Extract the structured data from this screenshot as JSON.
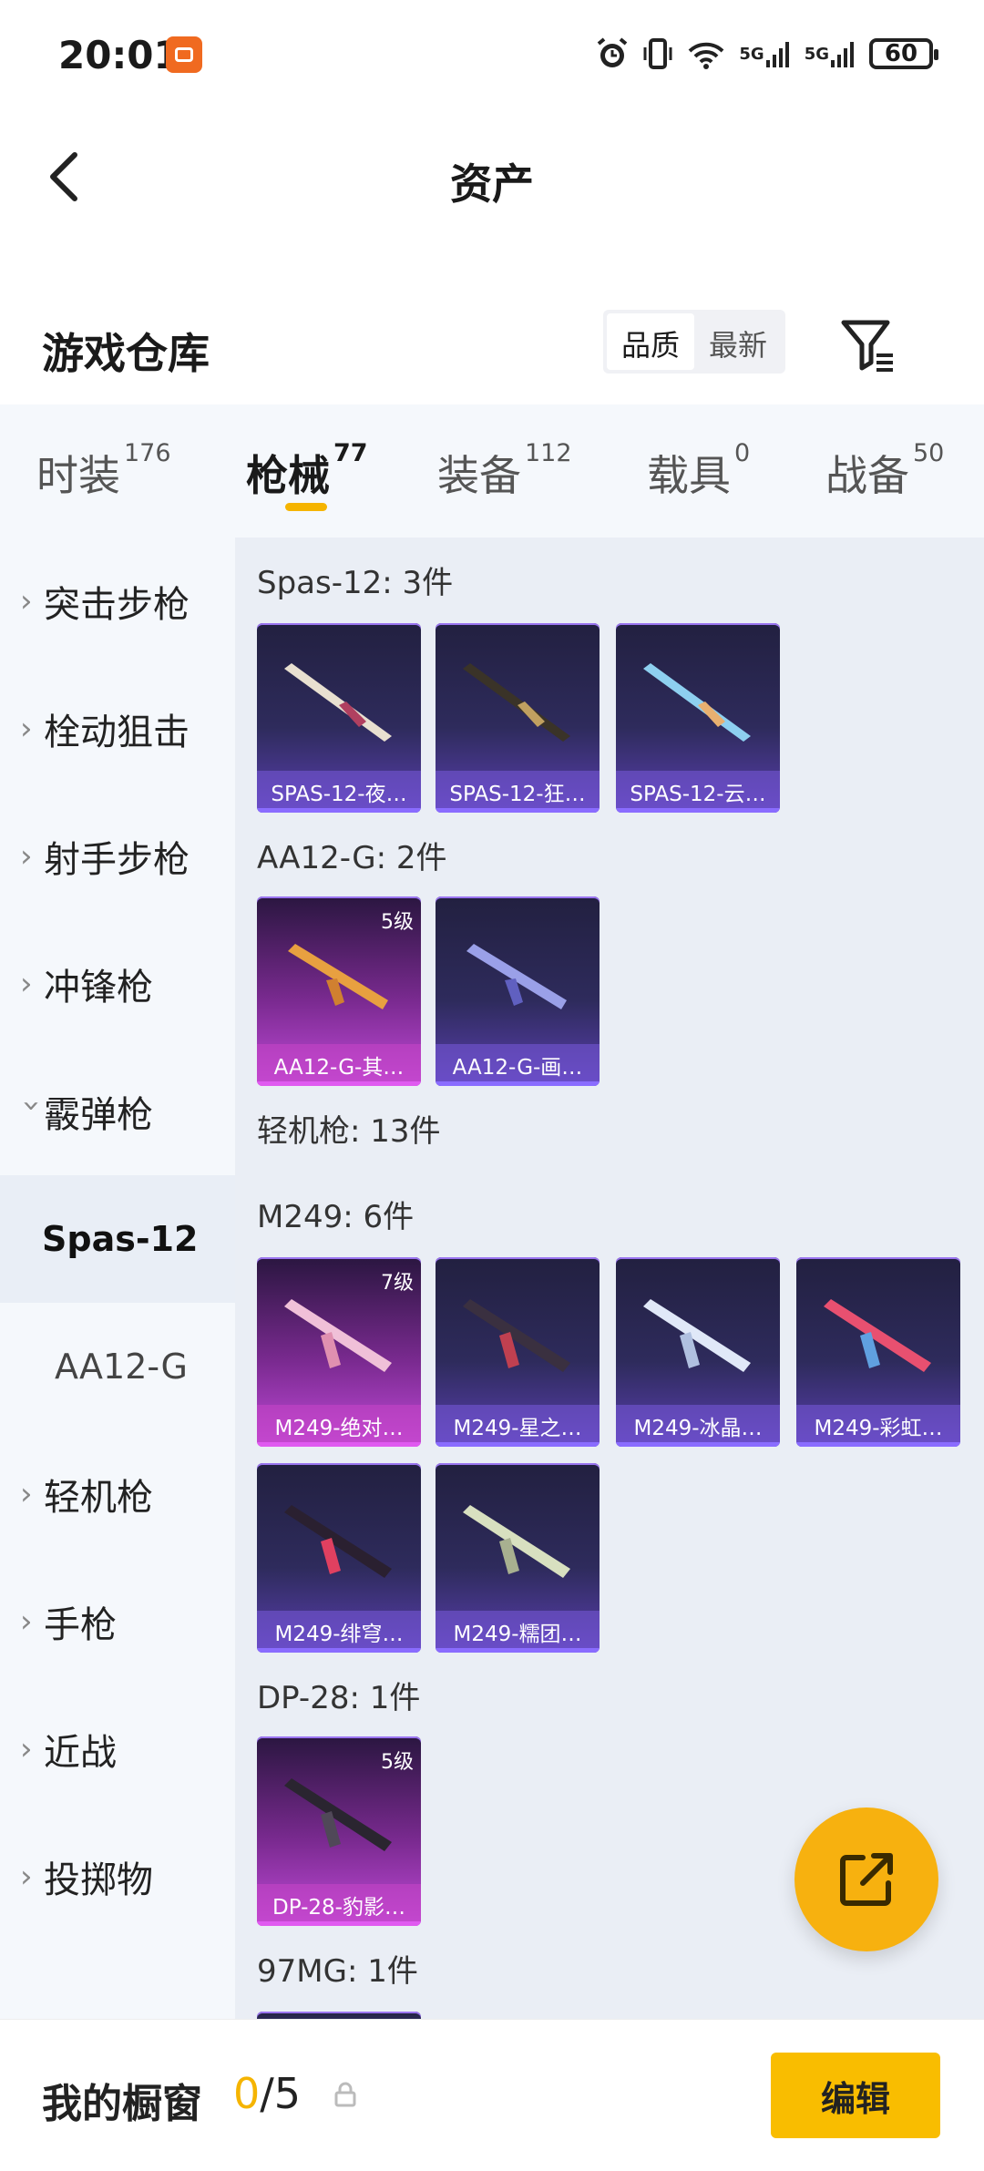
{
  "status_bar": {
    "time": "20:01",
    "battery": "60",
    "network1": "5G",
    "network2": "5G",
    "wifi_note": "6"
  },
  "nav": {
    "title": "资产"
  },
  "section": {
    "title": "游戏仓库",
    "sort_options": [
      "品质",
      "最新"
    ],
    "sort_selected": "品质"
  },
  "category_tabs": [
    {
      "label": "时装",
      "count": "176"
    },
    {
      "label": "枪械",
      "count": "77",
      "active": true
    },
    {
      "label": "装备",
      "count": "112"
    },
    {
      "label": "载具",
      "count": "0"
    },
    {
      "label": "战备",
      "count": "50"
    }
  ],
  "sidebar": {
    "items": [
      {
        "label": "突击步枪"
      },
      {
        "label": "栓动狙击"
      },
      {
        "label": "射手步枪"
      },
      {
        "label": "冲锋枪"
      },
      {
        "label": "霰弹枪"
      },
      {
        "label": "Spas-12"
      },
      {
        "label": "AA12-G"
      },
      {
        "label": "轻机枪"
      },
      {
        "label": "手枪"
      },
      {
        "label": "近战"
      },
      {
        "label": "投掷物"
      }
    ]
  },
  "content": {
    "groups": [
      {
        "title": "Spas-12: 3件",
        "items": [
          {
            "name": "SPAS-12-夜…",
            "style": "purple",
            "level": ""
          },
          {
            "name": "SPAS-12-狂…",
            "style": "purple",
            "level": ""
          },
          {
            "name": "SPAS-12-云…",
            "style": "purple",
            "level": ""
          }
        ]
      },
      {
        "title": "AA12-G: 2件",
        "items": [
          {
            "name": "AA12-G-其…",
            "style": "pink",
            "level": "5级"
          },
          {
            "name": "AA12-G-画…",
            "style": "purple",
            "level": ""
          }
        ]
      },
      {
        "title": "轻机枪: 13件",
        "items": []
      },
      {
        "title": "M249: 6件",
        "items": [
          {
            "name": "M249-绝对…",
            "style": "pink",
            "level": "7级"
          },
          {
            "name": "M249-星之…",
            "style": "purple",
            "level": ""
          },
          {
            "name": "M249-冰晶…",
            "style": "purple",
            "level": ""
          },
          {
            "name": "M249-彩虹…",
            "style": "purple",
            "level": ""
          },
          {
            "name": "M249-绯穹…",
            "style": "purple",
            "level": ""
          },
          {
            "name": "M249-糯团…",
            "style": "purple",
            "level": ""
          }
        ]
      },
      {
        "title": "DP-28: 1件",
        "items": [
          {
            "name": "DP-28-豹影…",
            "style": "pink",
            "level": "5级"
          }
        ]
      },
      {
        "title": "97MG: 1件",
        "items": []
      }
    ]
  },
  "footer": {
    "label": "我的橱窗",
    "count_current": "0",
    "count_total": "/5",
    "edit_label": "编辑"
  },
  "colors": {
    "accent": "#f9bd00",
    "purple_card": "#3a2f7a",
    "pink_card": "#a030b8"
  }
}
